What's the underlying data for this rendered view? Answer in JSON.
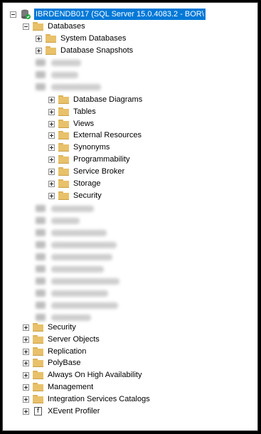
{
  "server": {
    "label": "IBRDENDB017 (SQL Server 15.0.4083.2 - BOR\\",
    "icon": "sql-server-icon",
    "selected_color": "#0078d7"
  },
  "databases": {
    "label": "Databases",
    "children": [
      {
        "label": "System Databases"
      },
      {
        "label": "Database Snapshots"
      }
    ]
  },
  "expanded_database": {
    "children": [
      {
        "label": "Database Diagrams"
      },
      {
        "label": "Tables"
      },
      {
        "label": "Views"
      },
      {
        "label": "External Resources"
      },
      {
        "label": "Synonyms"
      },
      {
        "label": "Programmability"
      },
      {
        "label": "Service Broker"
      },
      {
        "label": "Storage"
      },
      {
        "label": "Security"
      }
    ]
  },
  "server_nodes": [
    {
      "label": "Security"
    },
    {
      "label": "Server Objects"
    },
    {
      "label": "Replication"
    },
    {
      "label": "PolyBase"
    },
    {
      "label": "Always On High Availability"
    },
    {
      "label": "Management"
    },
    {
      "label": "Integration Services Catalogs"
    },
    {
      "label": "XEvent Profiler"
    }
  ]
}
